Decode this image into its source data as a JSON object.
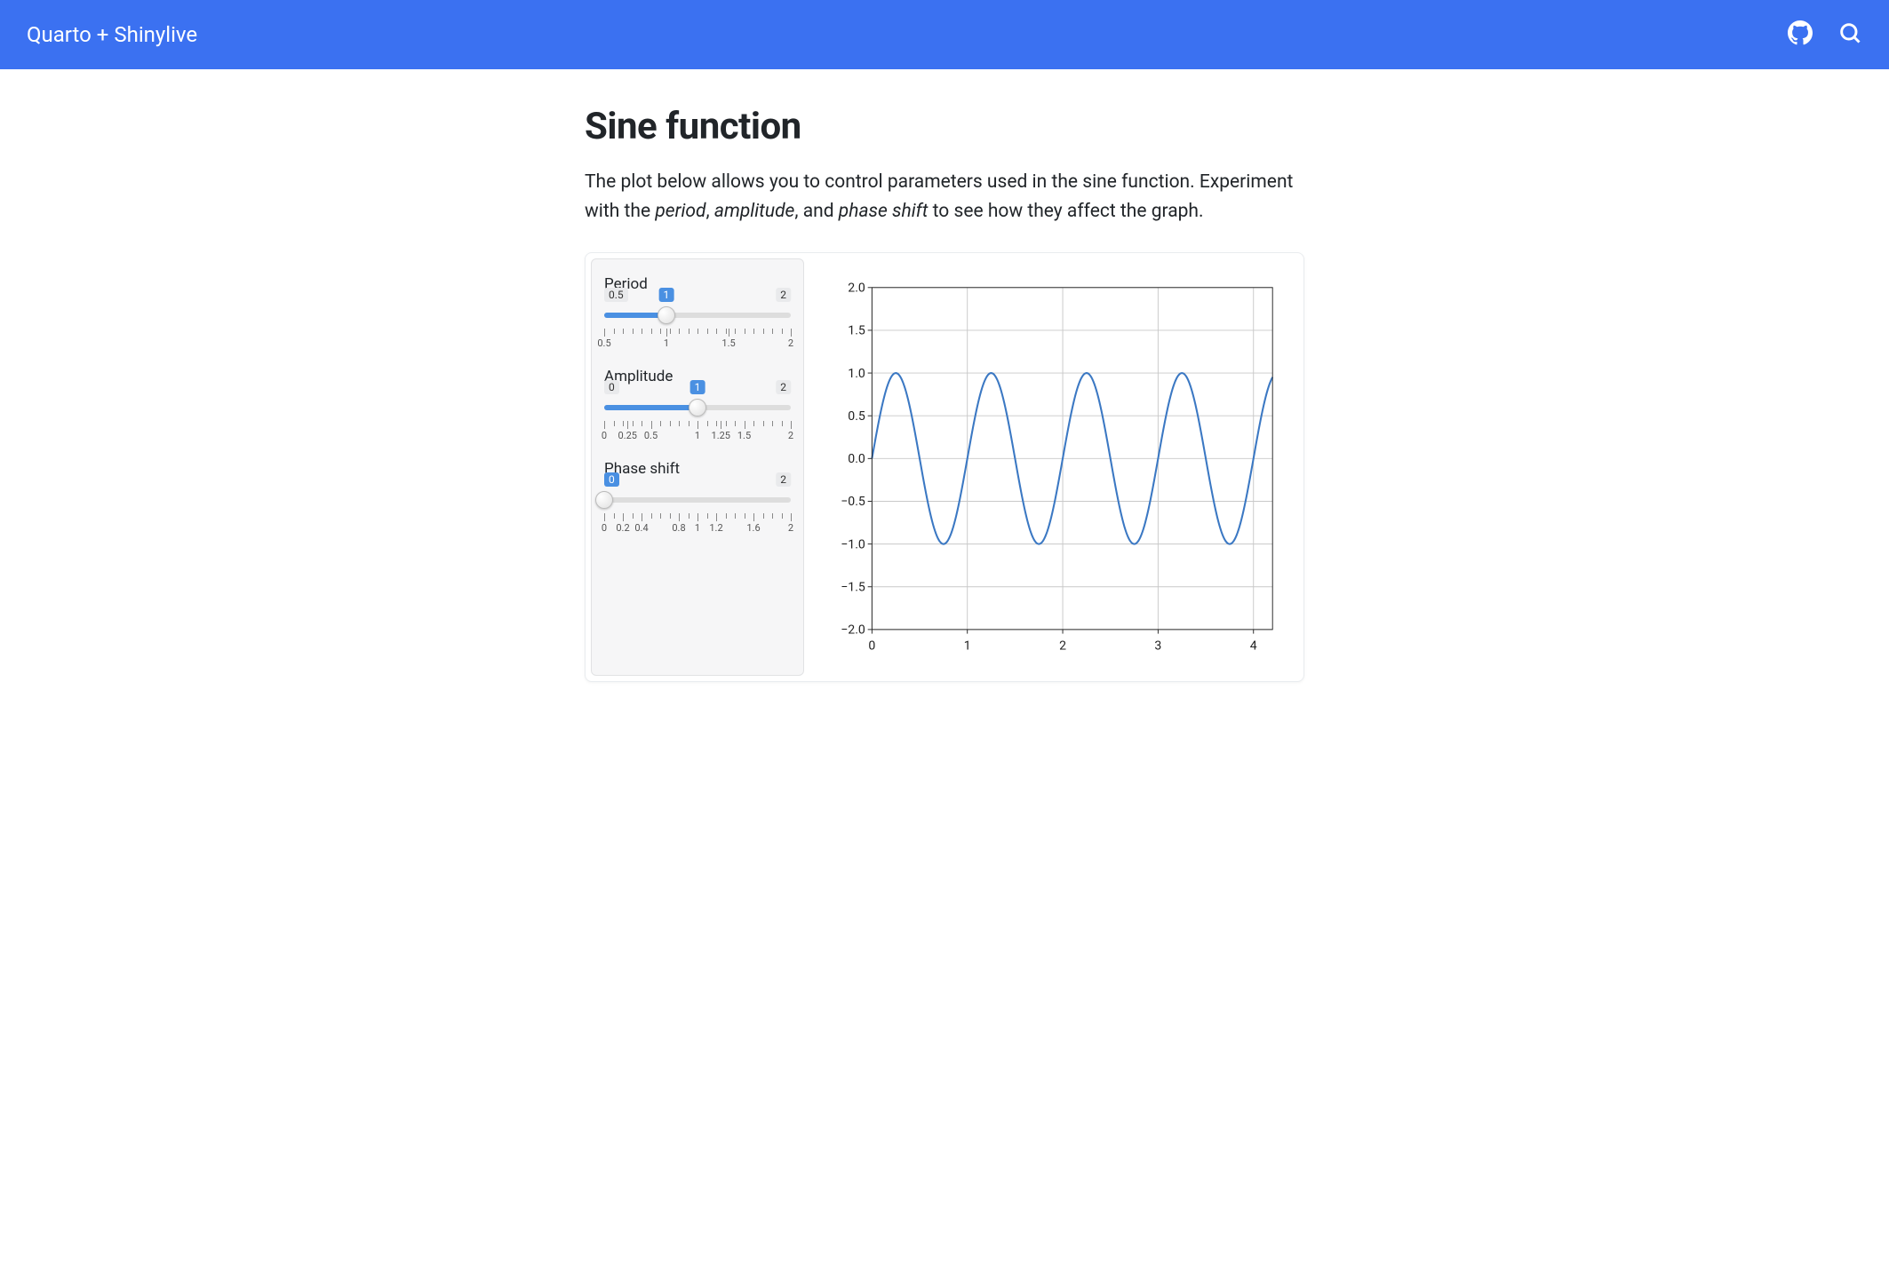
{
  "header": {
    "title": "Quarto + Shinylive"
  },
  "page": {
    "title": "Sine function",
    "description_pre": "The plot below allows you to control parameters used in the sine function. Experiment with the ",
    "description_em1": "period",
    "description_mid1": ", ",
    "description_em2": "amplitude",
    "description_mid2": ", and ",
    "description_em3": "phase shift",
    "description_post": " to see how they affect the graph."
  },
  "sliders": {
    "period": {
      "label": "Period",
      "min": "0.5",
      "max": "2",
      "value": "1",
      "value_frac": 0.333,
      "ticks": [
        "0.5",
        "1",
        "1.5",
        "2"
      ],
      "tick_fracs": [
        0,
        0.333,
        0.667,
        1
      ]
    },
    "amplitude": {
      "label": "Amplitude",
      "min": "0",
      "max": "2",
      "value": "1",
      "value_frac": 0.5,
      "ticks": [
        "0",
        "0.25",
        "0.5",
        "1",
        "1.25",
        "1.5",
        "2"
      ],
      "tick_fracs": [
        0,
        0.125,
        0.25,
        0.5,
        0.625,
        0.75,
        1
      ]
    },
    "phaseshift": {
      "label": "Phase shift",
      "min": "0",
      "max": "2",
      "value": "0",
      "value_frac": 0,
      "ticks": [
        "0",
        "0.2",
        "0.4",
        "0.8",
        "1",
        "1.2",
        "1.6",
        "2"
      ],
      "tick_fracs": [
        0,
        0.1,
        0.2,
        0.4,
        0.5,
        0.6,
        0.8,
        1
      ]
    }
  },
  "chart_data": {
    "type": "line",
    "title": "",
    "xlabel": "",
    "ylabel": "",
    "xlim": [
      0,
      4.2
    ],
    "ylim": [
      -2,
      2
    ],
    "x_ticks": [
      0,
      1,
      2,
      3,
      4
    ],
    "y_ticks": [
      -2.0,
      -1.5,
      -1.0,
      -0.5,
      0.0,
      0.5,
      1.0,
      1.5,
      2.0
    ],
    "y_tick_labels": [
      "−2.0",
      "−1.5",
      "−1.0",
      "−0.5",
      "0.0",
      "0.5",
      "1.0",
      "1.5",
      "2.0"
    ],
    "series": [
      {
        "name": "sine",
        "period": 1,
        "amplitude": 1,
        "phase_shift": 0,
        "color": "#3b78c3"
      }
    ]
  }
}
